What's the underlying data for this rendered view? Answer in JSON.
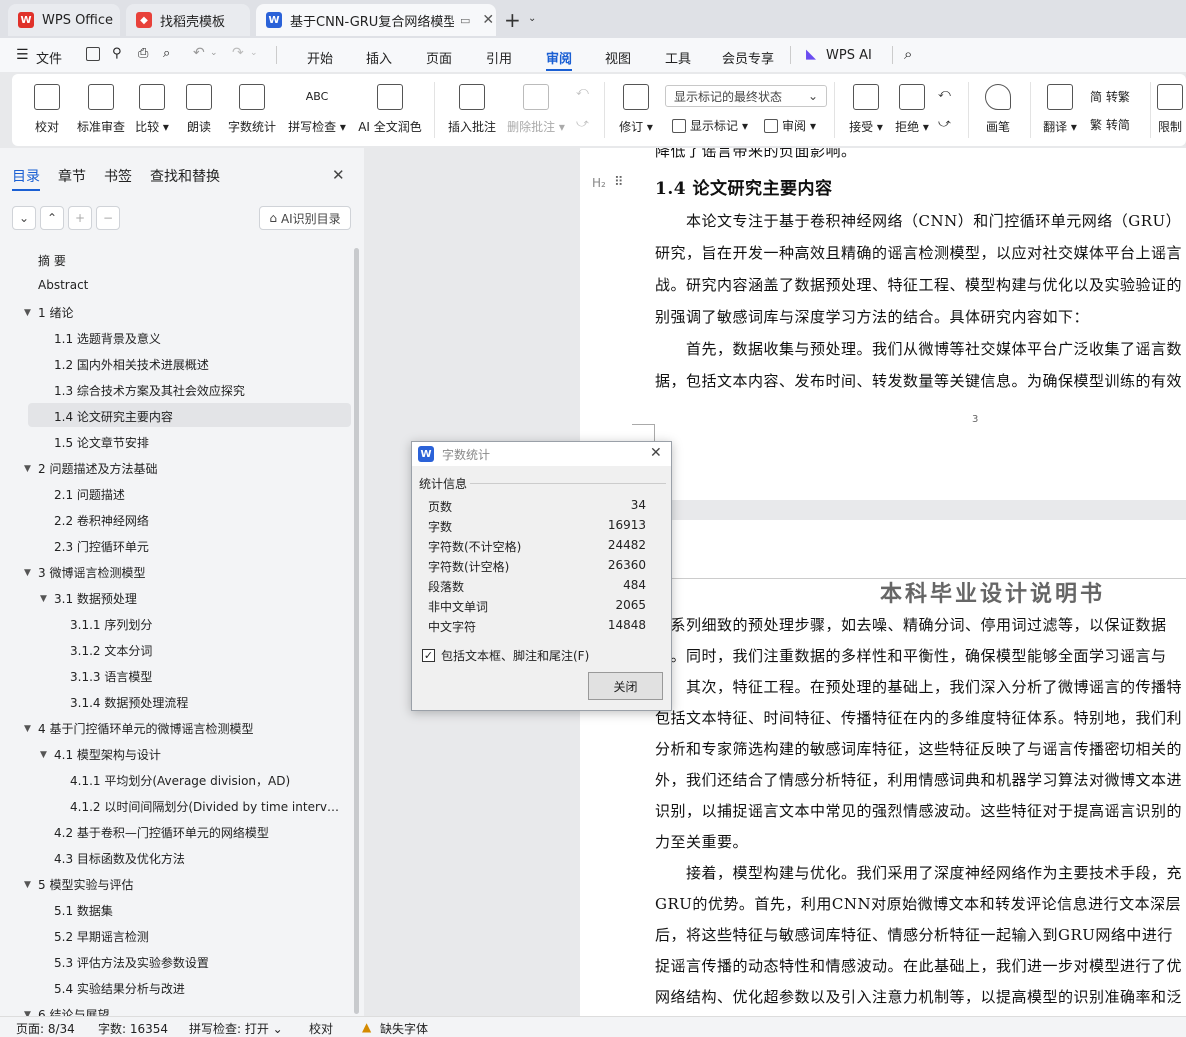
{
  "tabs": [
    {
      "label": "WPS Office",
      "icon": "wps-logo-icon"
    },
    {
      "label": "找稻壳模板",
      "icon": "docer-icon"
    },
    {
      "label": "基于CNN-GRU复合网络模型",
      "icon": "writer-doc-icon"
    }
  ],
  "menu": {
    "file": "文件",
    "items": [
      "开始",
      "插入",
      "页面",
      "引用",
      "审阅",
      "视图",
      "工具",
      "会员专享"
    ],
    "active": "审阅",
    "wps_ai": "WPS AI"
  },
  "ribbon": {
    "proofread": "校对",
    "standard_review": "标准审查",
    "compare": "比较",
    "read_aloud": "朗读",
    "word_count": "字数统计",
    "spell_check": "拼写检查",
    "ai_polish": "AI 全文润色",
    "insert_comment": "插入批注",
    "delete_comment": "删除批注",
    "track_changes": "修订",
    "markup_state": "显示标记的最终状态",
    "show_markup": "显示标记",
    "review_pane": "审阅",
    "accept": "接受",
    "reject": "拒绝",
    "pen": "画笔",
    "translate": "翻译",
    "to_traditional": "简 转繁",
    "to_simplified": "繁 转简",
    "restrict": "限制"
  },
  "sidebar": {
    "tabs": [
      "目录",
      "章节",
      "书签",
      "查找和替换"
    ],
    "ai_button": "AI识别目录",
    "toc": [
      {
        "label": "摘 要",
        "level": 0
      },
      {
        "label": "Abstract",
        "level": 0
      },
      {
        "label": "1 绪论",
        "level": 0,
        "arrow": true
      },
      {
        "label": "1.1 选题背景及意义",
        "level": 1
      },
      {
        "label": "1.2 国内外相关技术进展概述",
        "level": 1
      },
      {
        "label": "1.3 综合技术方案及其社会效应探究",
        "level": 1
      },
      {
        "label": "1.4 论文研究主要内容",
        "level": 1,
        "selected": true
      },
      {
        "label": "1.5 论文章节安排",
        "level": 1
      },
      {
        "label": "2 问题描述及方法基础",
        "level": 0,
        "arrow": true
      },
      {
        "label": "2.1 问题描述",
        "level": 1
      },
      {
        "label": "2.2 卷积神经网络",
        "level": 1
      },
      {
        "label": "2.3 门控循环单元",
        "level": 1
      },
      {
        "label": "3 微博谣言检测模型",
        "level": 0,
        "arrow": true
      },
      {
        "label": "3.1 数据预处理",
        "level": 1,
        "arrow": true
      },
      {
        "label": "3.1.1 序列划分",
        "level": 2
      },
      {
        "label": "3.1.2 文本分词",
        "level": 2
      },
      {
        "label": "3.1.3 语言模型",
        "level": 2
      },
      {
        "label": "3.1.4 数据预处理流程",
        "level": 2
      },
      {
        "label": "4 基于门控循环单元的微博谣言检测模型",
        "level": 0,
        "arrow": true
      },
      {
        "label": "4.1 模型架构与设计",
        "level": 1,
        "arrow": true
      },
      {
        "label": "4.1.1 平均划分(Average division，AD)",
        "level": 2
      },
      {
        "label": "4.1.2 以时间间隔划分(Divided by time interv…",
        "level": 2
      },
      {
        "label": "4.2 基于卷积—门控循环单元的网络模型",
        "level": 1
      },
      {
        "label": "4.3 目标函数及优化方法",
        "level": 1
      },
      {
        "label": "5 模型实验与评估",
        "level": 0,
        "arrow": true
      },
      {
        "label": "5.1 数据集",
        "level": 1
      },
      {
        "label": "5.2 早期谣言检测",
        "level": 1
      },
      {
        "label": "5.3 评估方法及实验参数设置",
        "level": 1
      },
      {
        "label": "5.4 实验结果分析与改进",
        "level": 1
      },
      {
        "label": "6 结论与展望",
        "level": 0,
        "arrow": true
      }
    ]
  },
  "document": {
    "top_fragment": "降低了谣言带来的负面影响。",
    "heading_marker": "H₂",
    "heading": "1.4  论文研究主要内容",
    "page1_lines": [
      "本论文专注于基于卷积神经网络（CNN）和门控循环单元网络（GRU）",
      "研究，旨在开发一种高效且精确的谣言检测模型，以应对社交媒体平台上谣言",
      "战。研究内容涵盖了数据预处理、特征工程、模型构建与优化以及实验验证的",
      "别强调了敏感词库与深度学习方法的结合。具体研究内容如下：",
      "首先，数据收集与预处理。我们从微博等社交媒体平台广泛收集了谣言数",
      "据，包括文本内容、发布时间、转发数量等关键信息。为确保模型训练的有效"
    ],
    "page_number": "3",
    "page2_header": "本科毕业设计说明书",
    "page2_lines": [
      "一系列细致的预处理步骤，如去噪、精确分词、停用词过滤等，以保证数据",
      "性。同时，我们注重数据的多样性和平衡性，确保模型能够全面学习谣言与",
      "其次，特征工程。在预处理的基础上，我们深入分析了微博谣言的传播特",
      "包括文本特征、时间特征、传播特征在内的多维度特征体系。特别地，我们利",
      "分析和专家筛选构建的敏感词库特征，这些特征反映了与谣言传播密切相关的",
      "外，我们还结合了情感分析特征，利用情感词典和机器学习算法对微博文本进",
      "识别，以捕捉谣言文本中常见的强烈情感波动。这些特征对于提高谣言识别的",
      "力至关重要。",
      "接着，模型构建与优化。我们采用了深度神经网络作为主要技术手段，充",
      "GRU的优势。首先，利用CNN对原始微博文本和转发评论信息进行文本深层",
      "后，将这些特征与敏感词库特征、情感分析特征一起输入到GRU网络中进行",
      "捉谣言传播的动态特性和情感波动。在此基础上，我们进一步对模型进行了优",
      "网络结构、优化超参数以及引入注意力机制等，以提高模型的识别准确率和泛"
    ]
  },
  "dialog": {
    "title": "字数统计",
    "section": "统计信息",
    "rows": [
      {
        "label": "页数",
        "value": "34"
      },
      {
        "label": "字数",
        "value": "16913"
      },
      {
        "label": "字符数(不计空格)",
        "value": "24482"
      },
      {
        "label": "字符数(计空格)",
        "value": "26360"
      },
      {
        "label": "段落数",
        "value": "484"
      },
      {
        "label": "非中文单词",
        "value": "2065"
      },
      {
        "label": "中文字符",
        "value": "14848"
      }
    ],
    "checkbox_label": "包括文本框、脚注和尾注(F)",
    "checkbox_checked": true,
    "close_button": "关闭"
  },
  "status": {
    "page": "页面: 8/34",
    "words": "字数: 16354",
    "spell": "拼写检查: 打开",
    "proof": "校对",
    "missing_font": "缺失字体"
  },
  "colors": {
    "accent": "#1a5fd3",
    "wps_red": "#e0312a"
  }
}
